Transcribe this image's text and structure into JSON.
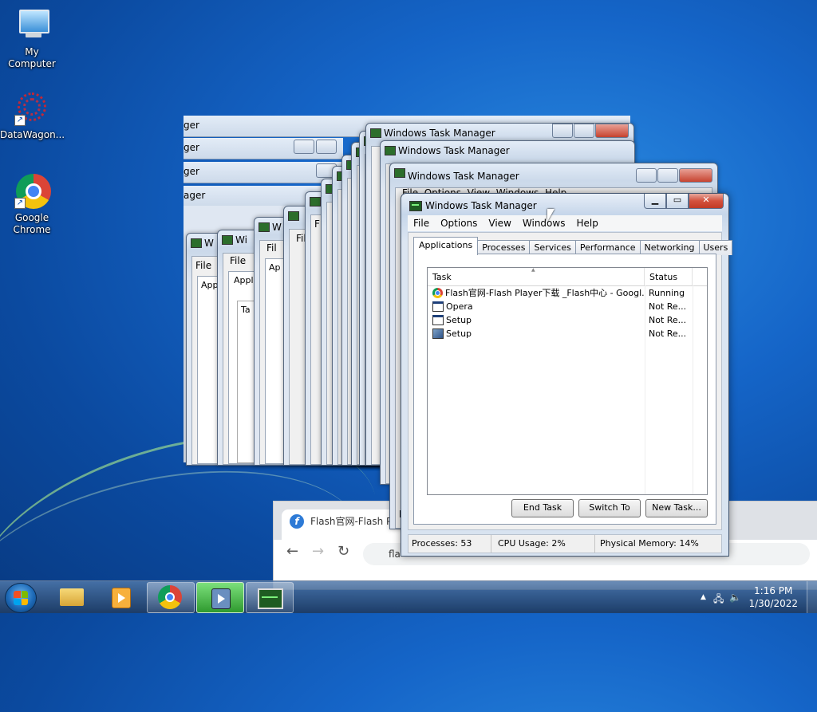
{
  "desktop_icons": [
    {
      "label": "My Computer"
    },
    {
      "label": "DataWagon..."
    },
    {
      "label": "Google Chrome"
    }
  ],
  "background_windows": {
    "title": "Windows Task Manager",
    "strip_title_fragment": "ger",
    "strip_title_fragment_2": "ager",
    "menu_file": "File",
    "tab_fragment": "Appli",
    "tab_fragment_2": "App",
    "tab_fragment_3": "Ap",
    "menu_fragment": "Fil",
    "menu_fragment_2": "F",
    "menu_fragment_3": "A",
    "task_fragment": "Ta",
    "window_fragment": "Wi",
    "window_fragment_2": "W",
    "second_title": "Windows Task Manager",
    "second_menu": "File  Options  View  Windows  Help",
    "side_fragment": "F",
    "side_fragment_2": "P"
  },
  "task_manager": {
    "title": "Windows Task Manager",
    "menu": [
      "File",
      "Options",
      "View",
      "Windows",
      "Help"
    ],
    "tabs": [
      "Applications",
      "Processes",
      "Services",
      "Performance",
      "Networking",
      "Users"
    ],
    "active_tab": "Applications",
    "columns": [
      "Task",
      "Status"
    ],
    "rows": [
      {
        "task": "Flash官网-Flash Player下载 _Flash中心 - Googl...",
        "status": "Running",
        "icon": "chrome-icon"
      },
      {
        "task": "Opera",
        "status": "Not Re...",
        "icon": "window-icon"
      },
      {
        "task": "Setup",
        "status": "Not Re...",
        "icon": "window-icon"
      },
      {
        "task": "Setup",
        "status": "Not Re...",
        "icon": "setup-icon"
      }
    ],
    "buttons": {
      "end_task": "End Task",
      "switch_to": "Switch To",
      "new_task": "New Task..."
    },
    "status": {
      "processes": "Processes: 53",
      "cpu": "CPU Usage: 2%",
      "memory": "Physical Memory: 14%"
    }
  },
  "browser": {
    "tab_title": "Flash官网-Flash Pla",
    "address_fragment": "fla"
  },
  "taskbar": {
    "time": "1:16 PM",
    "date": "1/30/2022"
  }
}
